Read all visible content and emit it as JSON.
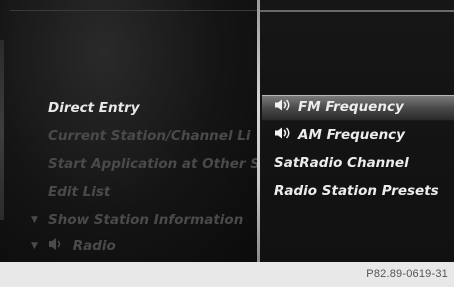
{
  "left_menu": {
    "items": [
      {
        "label": "Direct Entry",
        "state": "active",
        "arrow": ""
      },
      {
        "label": "Current Station/Channel Li",
        "state": "dim",
        "arrow": ""
      },
      {
        "label": "Start Application at Other S",
        "state": "dim",
        "arrow": ""
      },
      {
        "label": "Edit List",
        "state": "dim",
        "arrow": ""
      },
      {
        "label": "Show Station Information",
        "state": "dim",
        "arrow": "▼"
      },
      {
        "label": "Radio",
        "state": "dim",
        "arrow": "▼",
        "icon": "radio-icon"
      }
    ]
  },
  "right_menu": {
    "items": [
      {
        "label": "FM Frequency",
        "icon": "speaker-icon",
        "selected": true
      },
      {
        "label": "AM Frequency",
        "icon": "speaker-icon",
        "selected": false
      },
      {
        "label": "SatRadio Channel",
        "icon": "",
        "selected": false
      },
      {
        "label": "Radio Station Presets",
        "icon": "",
        "selected": false
      }
    ]
  },
  "caption": "P82.89-0619-31",
  "colors": {
    "background": "#0e0e0e",
    "text_active": "#e8e8e8",
    "text_dim": "#4a4a4a",
    "highlight": "#6a6a6a",
    "divider": "#c8c8c8"
  }
}
